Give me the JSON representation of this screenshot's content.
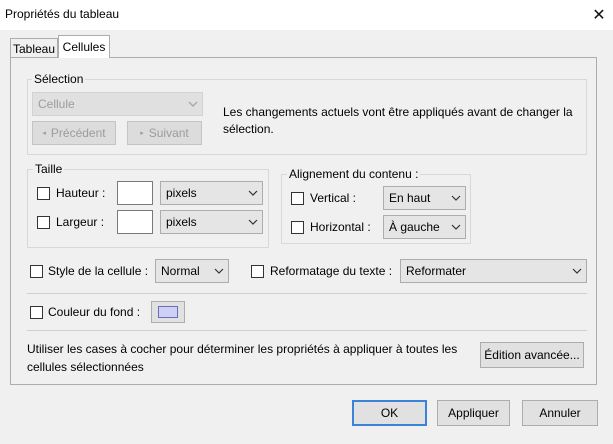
{
  "window": {
    "title": "Propriétés du tableau",
    "close_icon": "✕"
  },
  "tabs": [
    {
      "label": "Tableau"
    },
    {
      "label": "Cellules"
    }
  ],
  "selection": {
    "legend": "Sélection",
    "combo_value": "Cellule",
    "prev_label": "Précédent",
    "next_label": "Suivant",
    "info": "Les changements actuels vont être appliqués avant de changer la sélection."
  },
  "taille": {
    "legend": "Taille",
    "hauteur_label": "Hauteur :",
    "largeur_label": "Largeur :",
    "hauteur_unit": "pixels",
    "largeur_unit": "pixels"
  },
  "alignement": {
    "legend": "Alignement du contenu :",
    "vertical_label": "Vertical :",
    "horizontal_label": "Horizontal :",
    "vertical_value": "En haut",
    "horizontal_value": "À gauche"
  },
  "style": {
    "label": "Style de la cellule :",
    "value": "Normal",
    "reformat_label": "Reformatage du texte :",
    "reformat_value": "Reformater"
  },
  "fond": {
    "label": "Couleur du fond :",
    "swatch_color": "#cfd0f5"
  },
  "footer": {
    "hint": "Utiliser les cases à cocher pour déterminer les propriétés à appliquer à toutes les cellules sélectionnées",
    "advanced_label": "Édition avancée...",
    "ok_label": "OK",
    "apply_label": "Appliquer",
    "cancel_label": "Annuler"
  }
}
